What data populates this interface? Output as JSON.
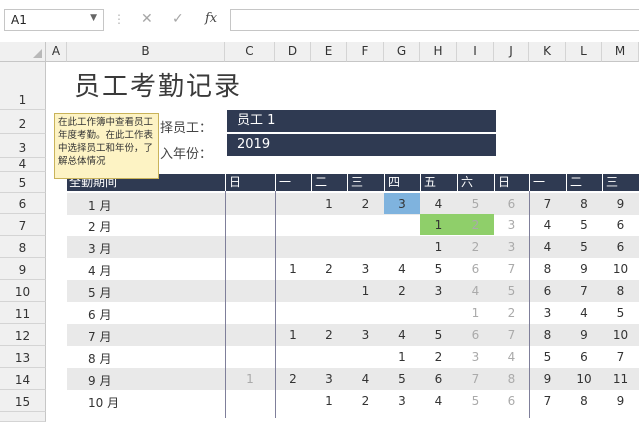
{
  "formula_bar": {
    "name_box": "A1",
    "cancel_icon": "✕",
    "confirm_icon": "✓",
    "fx_label": "fx",
    "formula": ""
  },
  "columns": [
    "A",
    "B",
    "C",
    "D",
    "E",
    "F",
    "G",
    "H",
    "I",
    "J",
    "K",
    "L",
    "M"
  ],
  "rows": [
    "1",
    "2",
    "3",
    "4",
    "5",
    "6",
    "7",
    "8",
    "9",
    "10",
    "11",
    "12",
    "13",
    "14",
    "15"
  ],
  "sheet": {
    "title": "员工考勤记录",
    "employee_label": "择员工：",
    "employee_value": "员工 1",
    "year_label": "入年份：",
    "year_value": "2019",
    "tooltip": "在此工作簿中查看员工年度考勤。在此工作表中选择员工和年份，了解总体情况",
    "month_header": "全勤期间",
    "day_headers": [
      "日",
      "一",
      "二",
      "三",
      "四",
      "五",
      "六",
      "日",
      "一",
      "二",
      "三"
    ],
    "months": [
      "1 月",
      "2 月",
      "3 月",
      "4 月",
      "5 月",
      "6 月",
      "7 月",
      "8 月",
      "9 月",
      "10 月"
    ],
    "grid": [
      [
        "",
        "",
        "1",
        "2",
        "3",
        "4",
        "5",
        "6",
        "7",
        "8",
        "9"
      ],
      [
        "",
        "",
        "",
        "",
        "",
        "1",
        "2",
        "3",
        "4",
        "5",
        "6"
      ],
      [
        "",
        "",
        "",
        "",
        "",
        "1",
        "2",
        "3",
        "4",
        "5",
        "6"
      ],
      [
        "",
        "1",
        "2",
        "3",
        "4",
        "5",
        "6",
        "7",
        "8",
        "9",
        "10"
      ],
      [
        "",
        "",
        "",
        "1",
        "2",
        "3",
        "4",
        "5",
        "6",
        "7",
        "8"
      ],
      [
        "",
        "",
        "",
        "",
        "",
        "",
        "1",
        "2",
        "3",
        "4",
        "5"
      ],
      [
        "",
        "1",
        "2",
        "3",
        "4",
        "5",
        "6",
        "7",
        "8",
        "9",
        "10"
      ],
      [
        "",
        "",
        "",
        "",
        "1",
        "2",
        "3",
        "4",
        "5",
        "6",
        "7"
      ],
      [
        "1",
        "2",
        "3",
        "4",
        "5",
        "6",
        "7",
        "8",
        "9",
        "10",
        "11"
      ],
      [
        "",
        "",
        "1",
        "2",
        "3",
        "4",
        "5",
        "6",
        "7",
        "8",
        "9"
      ]
    ],
    "colors": {
      "blue_highlight": "#7fb3de",
      "green_highlight": "#8fcf6a",
      "dark_header": "#2f3a52"
    }
  }
}
